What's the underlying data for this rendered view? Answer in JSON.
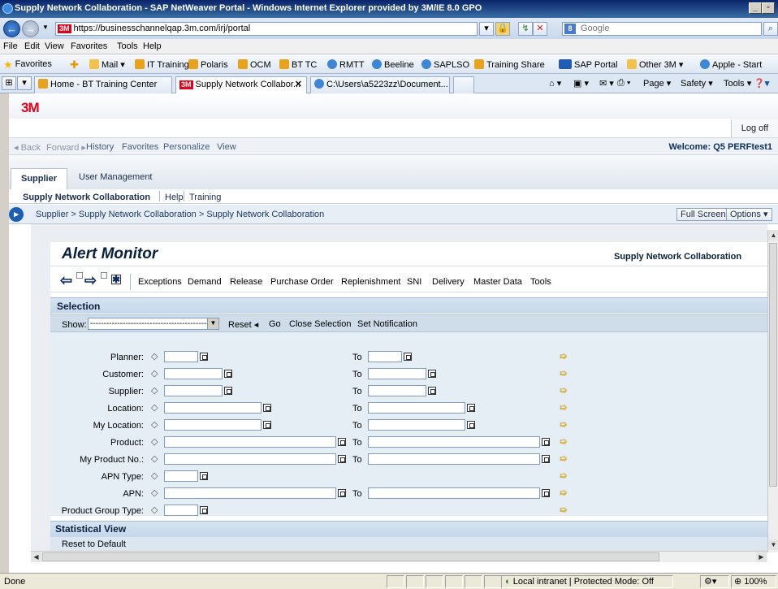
{
  "browser": {
    "title": "Supply Network Collaboration - SAP NetWeaver Portal - Windows Internet Explorer provided by 3M/IE 8.0 GPO",
    "url_brand": "3M",
    "url": "https://businesschannelqap.3m.com/irj/portal",
    "search_placeholder": "Google",
    "search_brand": "8",
    "menu": [
      "File",
      "Edit",
      "View",
      "Favorites",
      "Tools",
      "Help"
    ],
    "favorites_label": "Favorites",
    "favorites": [
      {
        "label": "Mail ▾",
        "icon": "folder-icon"
      },
      {
        "label": "IT Training",
        "icon": "sap-icon"
      },
      {
        "label": "Polaris",
        "icon": "sap-icon"
      },
      {
        "label": "OCM",
        "icon": "sap-icon"
      },
      {
        "label": "BT TC",
        "icon": "sap-icon"
      },
      {
        "label": "RMTT",
        "icon": "ie-page-icon"
      },
      {
        "label": "Beeline",
        "icon": "ie-page-icon"
      },
      {
        "label": "SAPLSO",
        "icon": "ie-page-icon"
      },
      {
        "label": "Training Share",
        "icon": "sap-icon"
      },
      {
        "label": "SAP Portal",
        "icon": "sap-logo-icon"
      },
      {
        "label": "Other 3M ▾",
        "icon": "folder-icon"
      },
      {
        "label": "Apple - Start",
        "icon": "ie-page-icon"
      }
    ],
    "tabs": [
      {
        "label": "Home - BT Training Center"
      },
      {
        "label": "Supply Network Collabor...",
        "brand": "3M"
      },
      {
        "label": "C:\\Users\\a5223zz\\Document..."
      }
    ],
    "commands": [
      "Page ▾",
      "Safety ▾",
      "Tools ▾"
    ],
    "status_done": "Done",
    "status_zone": "Local intranet | Protected Mode: Off",
    "zoom": "100%"
  },
  "portal": {
    "logo": "3M",
    "logoff": "Log off",
    "nav": {
      "back": "◂ Back",
      "forward": "Forward ▸",
      "items": [
        "History",
        "Favorites",
        "Personalize",
        "View"
      ]
    },
    "welcome": "Welcome: Q5 PERFtest1",
    "top_tabs": [
      "Supplier",
      "User Management"
    ],
    "second_level": [
      "Supply Network Collaboration",
      "Help",
      "Training"
    ],
    "breadcrumb": "Supplier  >  Supply Network Collaboration  >  Supply Network Collaboration",
    "full_screen": "Full Screen",
    "options": "Options ▾"
  },
  "alert_monitor": {
    "title": "Alert Monitor",
    "subtitle": "Supply Network Collaboration",
    "toolbar": [
      "Exceptions",
      "Demand",
      "Release",
      "Purchase Order",
      "Replenishment",
      "SNI",
      "Delivery",
      "Master Data",
      "Tools"
    ],
    "selection_title": "Selection",
    "show_label": "Show:",
    "show_value": "--------------------------------------------------",
    "show_actions": [
      "Reset ◂",
      "Go",
      "Close Selection",
      "Set Notification"
    ],
    "to_label": "To",
    "fields": [
      {
        "label": "Planner:",
        "has_to": true
      },
      {
        "label": "Customer:",
        "has_to": true
      },
      {
        "label": "Supplier:",
        "has_to": true
      },
      {
        "label": "Location:",
        "has_to": true
      },
      {
        "label": "My Location:",
        "has_to": true
      },
      {
        "label": "Product:",
        "has_to": true
      },
      {
        "label": "My Product No.:",
        "has_to": true
      },
      {
        "label": "APN Type:",
        "has_to": false
      },
      {
        "label": "APN:",
        "has_to": true
      },
      {
        "label": "Product Group Type:",
        "has_to": false
      }
    ],
    "statistical_title": "Statistical View",
    "reset_default": "Reset to Default"
  }
}
